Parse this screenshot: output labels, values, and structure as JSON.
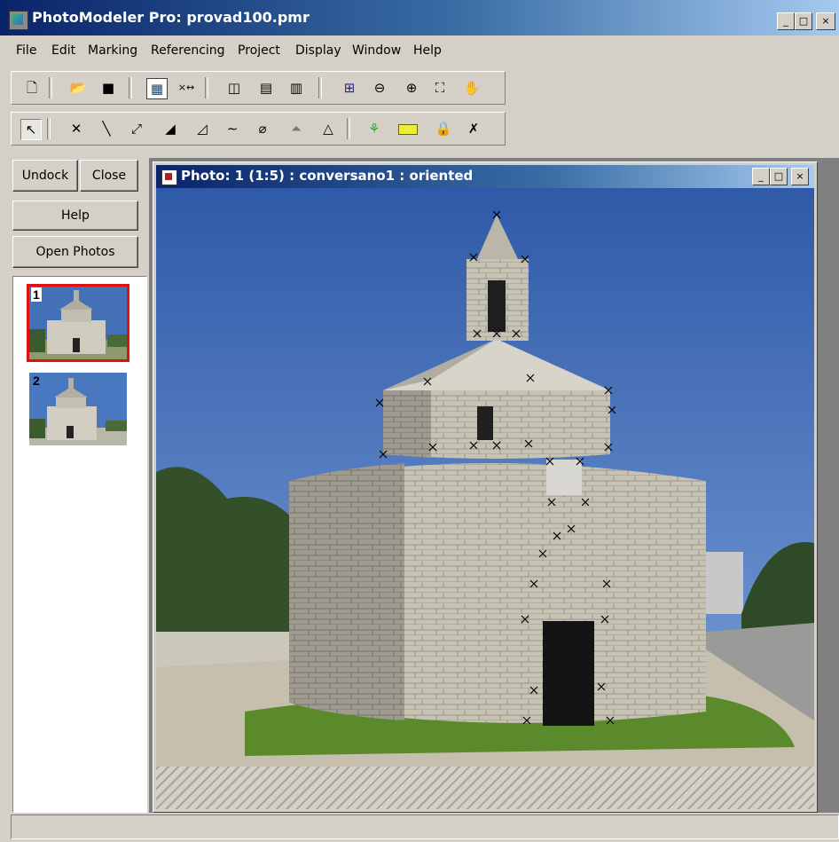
{
  "window": {
    "title": "PhotoModeler Pro: provad100.pmr",
    "controls": [
      "_",
      "□",
      "×"
    ]
  },
  "menu": [
    "File",
    "Edit",
    "Marking",
    "Referencing",
    "Project",
    "Display",
    "Window",
    "Help"
  ],
  "toolbar_top": [
    "new-file-icon",
    "open-folder-icon",
    "save-icon",
    "photo-table-icon",
    "point-table-icon",
    "3d-viewer-icon",
    "table-view-icon",
    "table-alt-icon",
    "zoom-region-icon",
    "zoom-out-icon",
    "zoom-in-icon",
    "zoom-fit-icon",
    "pan-hand-icon"
  ],
  "toolbar_bottom": [
    "select-arrow-icon",
    "point-mark-icon",
    "line-icon",
    "edge-icon",
    "cylinder-icon",
    "surface-icon",
    "curve-icon",
    "tube-icon",
    "cone-icon",
    "path-icon",
    "auto-surface-icon",
    "measure-ruler-icon",
    "lock-icon",
    "delete-mark-icon"
  ],
  "dock": {
    "undock_label": "Undock",
    "close_label": "Close",
    "help_label": "Help",
    "open_photos_label": "Open Photos",
    "thumbnails": [
      {
        "number": "1",
        "selected": true
      },
      {
        "number": "2",
        "selected": false
      }
    ]
  },
  "photo_window": {
    "title": "Photo: 1 (1:5) : conversano1 : oriented",
    "controls": [
      "_",
      "□",
      "×"
    ]
  },
  "colors": {
    "selection_border": "#e01010",
    "sky": "#3f68b0",
    "grass": "#5a8a2c",
    "stone": "#b8b4a8"
  }
}
